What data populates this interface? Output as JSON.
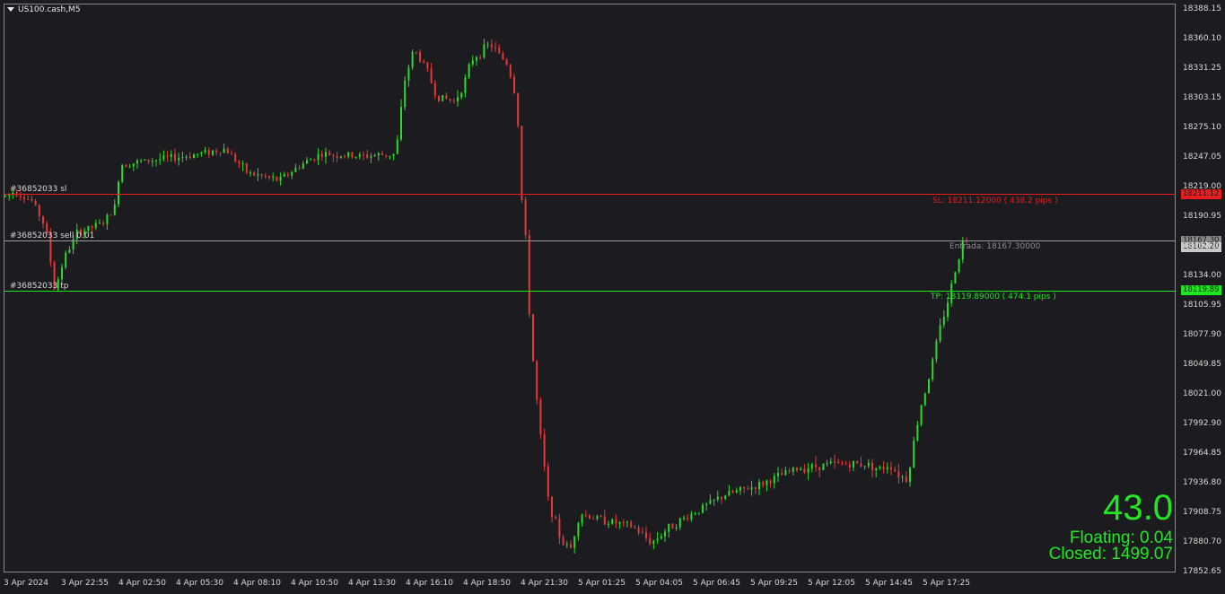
{
  "symbol": "US100.cash,M5",
  "y_axis_labels": [
    "18388.15",
    "18360.10",
    "18331.25",
    "18303.15",
    "18275.10",
    "18247.05",
    "18219.00",
    "18190.95",
    "18162.20",
    "18134.00",
    "18105.95",
    "18077.90",
    "18049.85",
    "18021.00",
    "17992.90",
    "17964.85",
    "17936.80",
    "17908.75",
    "17880.70",
    "17852.65"
  ],
  "x_axis_labels": [
    "3 Apr 2024",
    "3 Apr 22:55",
    "4 Apr 02:50",
    "4 Apr 05:30",
    "4 Apr 08:10",
    "4 Apr 10:50",
    "4 Apr 13:30",
    "4 Apr 16:10",
    "4 Apr 18:50",
    "4 Apr 21:30",
    "5 Apr 01:25",
    "5 Apr 04:05",
    "5 Apr 06:45",
    "5 Apr 09:25",
    "5 Apr 12:05",
    "5 Apr 14:45",
    "5 Apr 17:25"
  ],
  "lines": {
    "sl": {
      "tag": "#36852033 sl",
      "label": "SL: 18211.12000 ( 438.2 pips )",
      "price_box": "18211.12",
      "color": "#e81c1c"
    },
    "entry": {
      "tag": "#36852033 sell 0.01",
      "label": "Entrada: 18167.30000",
      "price_box": "18167.30",
      "price_box_2": "18162.20",
      "color": "#9a9a9a"
    },
    "tp": {
      "tag": "#36852033 tp",
      "label": "TP: 18119.89000 ( 474.1 pips )",
      "price_box": "18119.89",
      "color": "#1ce81c"
    }
  },
  "stats": {
    "profit": "43.0",
    "floating": "Floating: 0.04",
    "closed": "Closed: 1499.07"
  },
  "colors": {
    "background": "#1c1c20",
    "bull": "#2ed82e",
    "bear": "#e23a3a",
    "text": "#d8d8d8"
  },
  "chart_data": {
    "type": "candlestick",
    "ylim": [
      17852.65,
      18388.15
    ],
    "anchors": [
      [
        0,
        18210
      ],
      [
        10,
        18215
      ],
      [
        30,
        18205
      ],
      [
        45,
        18180
      ],
      [
        55,
        18120
      ],
      [
        65,
        18150
      ],
      [
        80,
        18175
      ],
      [
        110,
        18185
      ],
      [
        122,
        18200
      ],
      [
        128,
        18240
      ],
      [
        170,
        18245
      ],
      [
        200,
        18248
      ],
      [
        245,
        18255
      ],
      [
        270,
        18232
      ],
      [
        305,
        18225
      ],
      [
        330,
        18240
      ],
      [
        350,
        18250
      ],
      [
        395,
        18248
      ],
      [
        435,
        18250
      ],
      [
        445,
        18320
      ],
      [
        455,
        18350
      ],
      [
        470,
        18330
      ],
      [
        480,
        18305
      ],
      [
        500,
        18300
      ],
      [
        510,
        18315
      ],
      [
        520,
        18340
      ],
      [
        540,
        18355
      ],
      [
        560,
        18335
      ],
      [
        570,
        18300
      ],
      [
        575,
        18210
      ],
      [
        580,
        18165
      ],
      [
        585,
        18080
      ],
      [
        595,
        17990
      ],
      [
        605,
        17920
      ],
      [
        620,
        17880
      ],
      [
        630,
        17875
      ],
      [
        640,
        17908
      ],
      [
        660,
        17903
      ],
      [
        700,
        17895
      ],
      [
        720,
        17880
      ],
      [
        740,
        17895
      ],
      [
        770,
        17910
      ],
      [
        800,
        17925
      ],
      [
        840,
        17935
      ],
      [
        880,
        17950
      ],
      [
        920,
        17955
      ],
      [
        960,
        17955
      ],
      [
        975,
        17950
      ],
      [
        985,
        17955
      ],
      [
        995,
        17945
      ],
      [
        1005,
        17940
      ],
      [
        1012,
        17975
      ],
      [
        1020,
        18010
      ],
      [
        1030,
        18040
      ],
      [
        1040,
        18080
      ],
      [
        1050,
        18110
      ],
      [
        1060,
        18145
      ],
      [
        1068,
        18170
      ],
      [
        1080,
        18165
      ]
    ]
  }
}
